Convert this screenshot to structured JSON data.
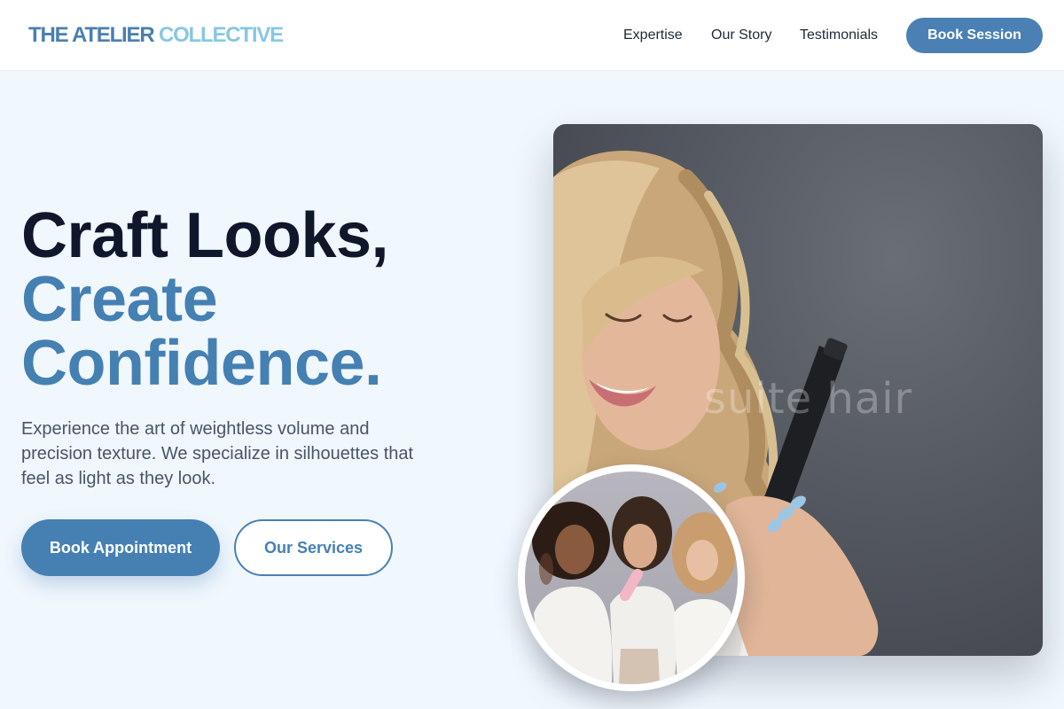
{
  "header": {
    "logo_part1": "THE ATELIER",
    "logo_part2": "COLLECTIVE",
    "nav": [
      "Expertise",
      "Our Story",
      "Testimonials"
    ],
    "cta_label": "Book Session"
  },
  "hero": {
    "headline_line1": "Craft Looks,",
    "headline_line2": "Create",
    "headline_line3": "Confidence.",
    "subtitle": "Experience the art of weightless volume and precision texture. We specialize in silhouettes that feel as light as they look.",
    "primary_button": "Book Appointment",
    "secondary_button": "Our Services",
    "image_watermark": "suite hair"
  },
  "colors": {
    "accent": "#4a80b4",
    "logo_light": "#86c7e3",
    "background": "#f0f7fd",
    "heading_dark": "#0f172a"
  }
}
